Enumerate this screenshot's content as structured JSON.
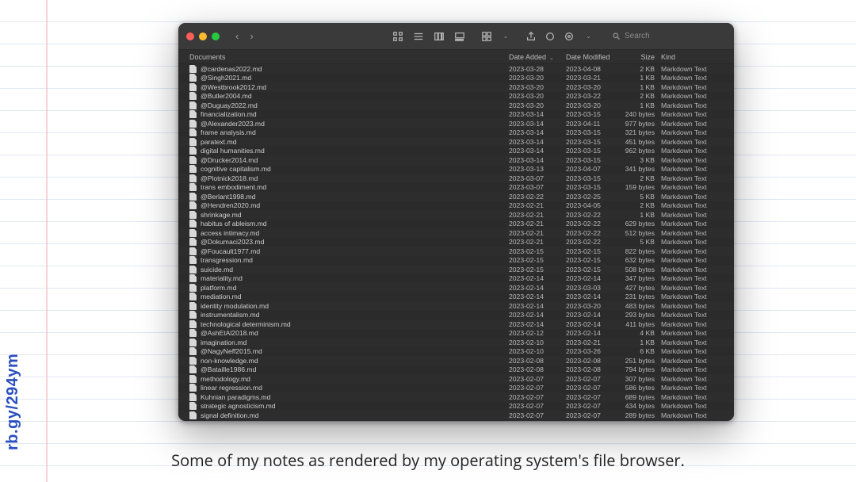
{
  "side_url": "rb.gy/294ym",
  "caption": "Some of my notes as rendered by my operating system's file browser.",
  "search": {
    "placeholder": "Search"
  },
  "columns": {
    "name": "Documents",
    "added": "Date Added",
    "modified": "Date Modified",
    "size": "Size",
    "kind": "Kind"
  },
  "files": [
    {
      "name": "@cardenas2022.md",
      "added": "2023-03-28",
      "modified": "2023-04-08",
      "size": "2 KB",
      "kind": "Markdown Text"
    },
    {
      "name": "@Singh2021.md",
      "added": "2023-03-20",
      "modified": "2023-03-21",
      "size": "1 KB",
      "kind": "Markdown Text"
    },
    {
      "name": "@Westbrook2012.md",
      "added": "2023-03-20",
      "modified": "2023-03-20",
      "size": "1 KB",
      "kind": "Markdown Text"
    },
    {
      "name": "@Butler2004.md",
      "added": "2023-03-20",
      "modified": "2023-03-22",
      "size": "2 KB",
      "kind": "Markdown Text"
    },
    {
      "name": "@Duguay2022.md",
      "added": "2023-03-20",
      "modified": "2023-03-20",
      "size": "1 KB",
      "kind": "Markdown Text"
    },
    {
      "name": "financialization.md",
      "added": "2023-03-14",
      "modified": "2023-03-15",
      "size": "240 bytes",
      "kind": "Markdown Text"
    },
    {
      "name": "@Alexander2023.md",
      "added": "2023-03-14",
      "modified": "2023-04-11",
      "size": "977 bytes",
      "kind": "Markdown Text"
    },
    {
      "name": "frame analysis.md",
      "added": "2023-03-14",
      "modified": "2023-03-15",
      "size": "321 bytes",
      "kind": "Markdown Text"
    },
    {
      "name": "paratext.md",
      "added": "2023-03-14",
      "modified": "2023-03-15",
      "size": "451 bytes",
      "kind": "Markdown Text"
    },
    {
      "name": "digital humanities.md",
      "added": "2023-03-14",
      "modified": "2023-03-15",
      "size": "962 bytes",
      "kind": "Markdown Text"
    },
    {
      "name": "@Drucker2014.md",
      "added": "2023-03-14",
      "modified": "2023-03-15",
      "size": "3 KB",
      "kind": "Markdown Text"
    },
    {
      "name": "cognitive capitalism.md",
      "added": "2023-03-13",
      "modified": "2023-04-07",
      "size": "341 bytes",
      "kind": "Markdown Text"
    },
    {
      "name": "@Plotnick2018.md",
      "added": "2023-03-07",
      "modified": "2023-03-15",
      "size": "2 KB",
      "kind": "Markdown Text"
    },
    {
      "name": "trans embodiment.md",
      "added": "2023-03-07",
      "modified": "2023-03-15",
      "size": "159 bytes",
      "kind": "Markdown Text"
    },
    {
      "name": "@Berlant1998.md",
      "added": "2023-02-22",
      "modified": "2023-02-25",
      "size": "5 KB",
      "kind": "Markdown Text"
    },
    {
      "name": "@Hendren2020.md",
      "added": "2023-02-21",
      "modified": "2023-04-05",
      "size": "2 KB",
      "kind": "Markdown Text"
    },
    {
      "name": "shrinkage.md",
      "added": "2023-02-21",
      "modified": "2023-02-22",
      "size": "1 KB",
      "kind": "Markdown Text"
    },
    {
      "name": "habitus of ableism.md",
      "added": "2023-02-21",
      "modified": "2023-02-22",
      "size": "629 bytes",
      "kind": "Markdown Text"
    },
    {
      "name": "access intimacy.md",
      "added": "2023-02-21",
      "modified": "2023-02-22",
      "size": "512 bytes",
      "kind": "Markdown Text"
    },
    {
      "name": "@Dokumaci2023.md",
      "added": "2023-02-21",
      "modified": "2023-02-22",
      "size": "5 KB",
      "kind": "Markdown Text"
    },
    {
      "name": "@Foucault1977.md",
      "added": "2023-02-15",
      "modified": "2023-02-15",
      "size": "822 bytes",
      "kind": "Markdown Text"
    },
    {
      "name": "transgression.md",
      "added": "2023-02-15",
      "modified": "2023-02-15",
      "size": "632 bytes",
      "kind": "Markdown Text"
    },
    {
      "name": "suicide.md",
      "added": "2023-02-15",
      "modified": "2023-02-15",
      "size": "508 bytes",
      "kind": "Markdown Text"
    },
    {
      "name": "materiality.md",
      "added": "2023-02-14",
      "modified": "2023-02-14",
      "size": "347 bytes",
      "kind": "Markdown Text"
    },
    {
      "name": "platform.md",
      "added": "2023-02-14",
      "modified": "2023-03-03",
      "size": "427 bytes",
      "kind": "Markdown Text"
    },
    {
      "name": "mediation.md",
      "added": "2023-02-14",
      "modified": "2023-02-14",
      "size": "231 bytes",
      "kind": "Markdown Text"
    },
    {
      "name": "identity modulation.md",
      "added": "2023-02-14",
      "modified": "2023-03-20",
      "size": "483 bytes",
      "kind": "Markdown Text"
    },
    {
      "name": "instrumentalism.md",
      "added": "2023-02-14",
      "modified": "2023-02-14",
      "size": "293 bytes",
      "kind": "Markdown Text"
    },
    {
      "name": "technological determinism.md",
      "added": "2023-02-14",
      "modified": "2023-02-14",
      "size": "411 bytes",
      "kind": "Markdown Text"
    },
    {
      "name": "@AshEtAl2018.md",
      "added": "2023-02-12",
      "modified": "2023-02-14",
      "size": "4 KB",
      "kind": "Markdown Text"
    },
    {
      "name": "imagination.md",
      "added": "2023-02-10",
      "modified": "2023-02-21",
      "size": "1 KB",
      "kind": "Markdown Text"
    },
    {
      "name": "@NagyNeff2015.md",
      "added": "2023-02-10",
      "modified": "2023-03-26",
      "size": "6 KB",
      "kind": "Markdown Text"
    },
    {
      "name": "non-knowledge.md",
      "added": "2023-02-08",
      "modified": "2023-02-08",
      "size": "251 bytes",
      "kind": "Markdown Text"
    },
    {
      "name": "@Bataille1986.md",
      "added": "2023-02-08",
      "modified": "2023-02-08",
      "size": "794 bytes",
      "kind": "Markdown Text"
    },
    {
      "name": "methodology.md",
      "added": "2023-02-07",
      "modified": "2023-02-07",
      "size": "307 bytes",
      "kind": "Markdown Text"
    },
    {
      "name": "linear regression.md",
      "added": "2023-02-07",
      "modified": "2023-02-07",
      "size": "586 bytes",
      "kind": "Markdown Text"
    },
    {
      "name": "Kuhnian paradigms.md",
      "added": "2023-02-07",
      "modified": "2023-02-07",
      "size": "689 bytes",
      "kind": "Markdown Text"
    },
    {
      "name": "strategic agnosticism.md",
      "added": "2023-02-07",
      "modified": "2023-02-07",
      "size": "434 bytes",
      "kind": "Markdown Text"
    },
    {
      "name": "signal definition.md",
      "added": "2023-02-07",
      "modified": "2023-02-07",
      "size": "289 bytes",
      "kind": "Markdown Text"
    }
  ]
}
